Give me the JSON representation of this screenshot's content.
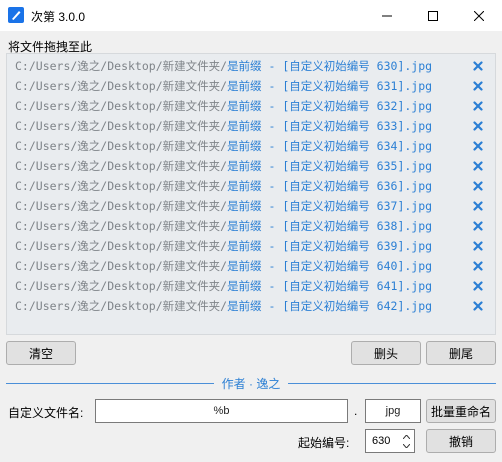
{
  "window": {
    "title": "次第 3.0.0"
  },
  "drop_label": "将文件拖拽至此",
  "file_prefix": "C:/Users/逸之/Desktop/新建文件夹/",
  "files": [
    {
      "newname": "是前缀 - [自定义初始编号 630].jpg"
    },
    {
      "newname": "是前缀 - [自定义初始编号 631].jpg"
    },
    {
      "newname": "是前缀 - [自定义初始编号 632].jpg"
    },
    {
      "newname": "是前缀 - [自定义初始编号 633].jpg"
    },
    {
      "newname": "是前缀 - [自定义初始编号 634].jpg"
    },
    {
      "newname": "是前缀 - [自定义初始编号 635].jpg"
    },
    {
      "newname": "是前缀 - [自定义初始编号 636].jpg"
    },
    {
      "newname": "是前缀 - [自定义初始编号 637].jpg"
    },
    {
      "newname": "是前缀 - [自定义初始编号 638].jpg"
    },
    {
      "newname": "是前缀 - [自定义初始编号 639].jpg"
    },
    {
      "newname": "是前缀 - [自定义初始编号 640].jpg"
    },
    {
      "newname": "是前缀 - [自定义初始编号 641].jpg"
    },
    {
      "newname": "是前缀 - [自定义初始编号 642].jpg"
    }
  ],
  "buttons": {
    "clear": "清空",
    "trim_head": "删头",
    "trim_tail": "删尾",
    "batch_rename": "批量重命名",
    "undo": "撤销"
  },
  "author": "作者 · 逸之",
  "form": {
    "filename_label": "自定义文件名:",
    "filename_value": "%b",
    "dot": ".",
    "extension_value": "jpg",
    "start_label": "起始编号:",
    "start_value": "630"
  },
  "colors": {
    "accent": "#2b7fd4",
    "path_gray": "#7f8489",
    "list_bg": "#e9ecef",
    "app_icon": "#1a73e8"
  }
}
